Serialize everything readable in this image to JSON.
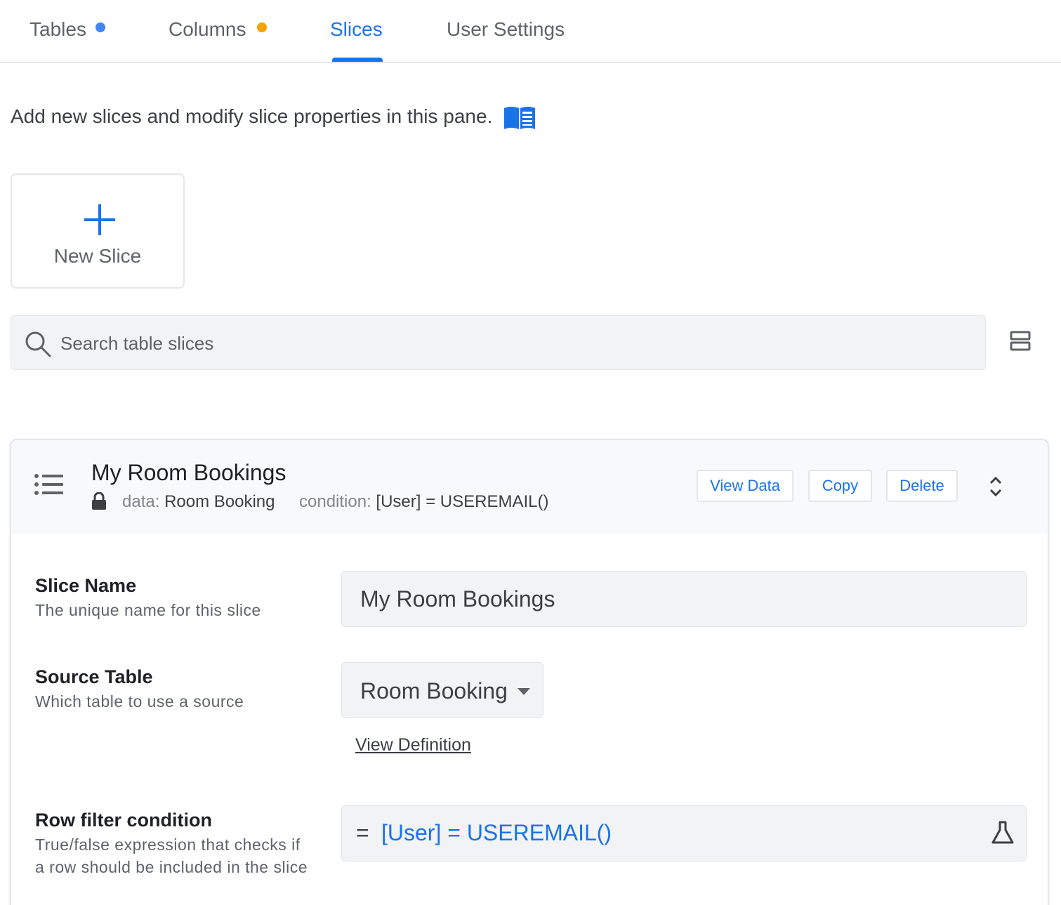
{
  "tabs": [
    {
      "label": "Tables",
      "badge_color": "#4285f4"
    },
    {
      "label": "Columns",
      "badge_color": "#f4a300"
    },
    {
      "label": "Slices",
      "active": true
    },
    {
      "label": "User Settings"
    }
  ],
  "intro": {
    "text": "Add new slices and modify slice properties in this pane.",
    "icon": "book-icon"
  },
  "new_slice": {
    "label": "New Slice",
    "icon": "plus-icon"
  },
  "search": {
    "placeholder": "Search table slices",
    "icon": "search-icon",
    "view_toggle_icon": "view-agenda-icon"
  },
  "slice": {
    "title": "My Room Bookings",
    "data_key": "data:",
    "data_value": "Room Booking",
    "condition_key": "condition:",
    "condition_value": "[User] = USEREMAIL()",
    "buttons": {
      "view_data": "View Data",
      "copy": "Copy",
      "delete": "Delete"
    },
    "fields": {
      "slice_name": {
        "label": "Slice Name",
        "help": "The unique name for this slice",
        "value": "My Room Bookings"
      },
      "source_table": {
        "label": "Source Table",
        "help": "Which table to use a source",
        "value": "Room Booking",
        "link": "View Definition"
      },
      "row_filter": {
        "label": "Row filter condition",
        "help": "True/false expression that checks if a row should be included in the slice",
        "prefix": "=",
        "expression": "[User] = USEREMAIL()"
      }
    }
  },
  "colors": {
    "accent": "#1a73e8",
    "text": "#3c4043",
    "muted": "#5f6368"
  }
}
